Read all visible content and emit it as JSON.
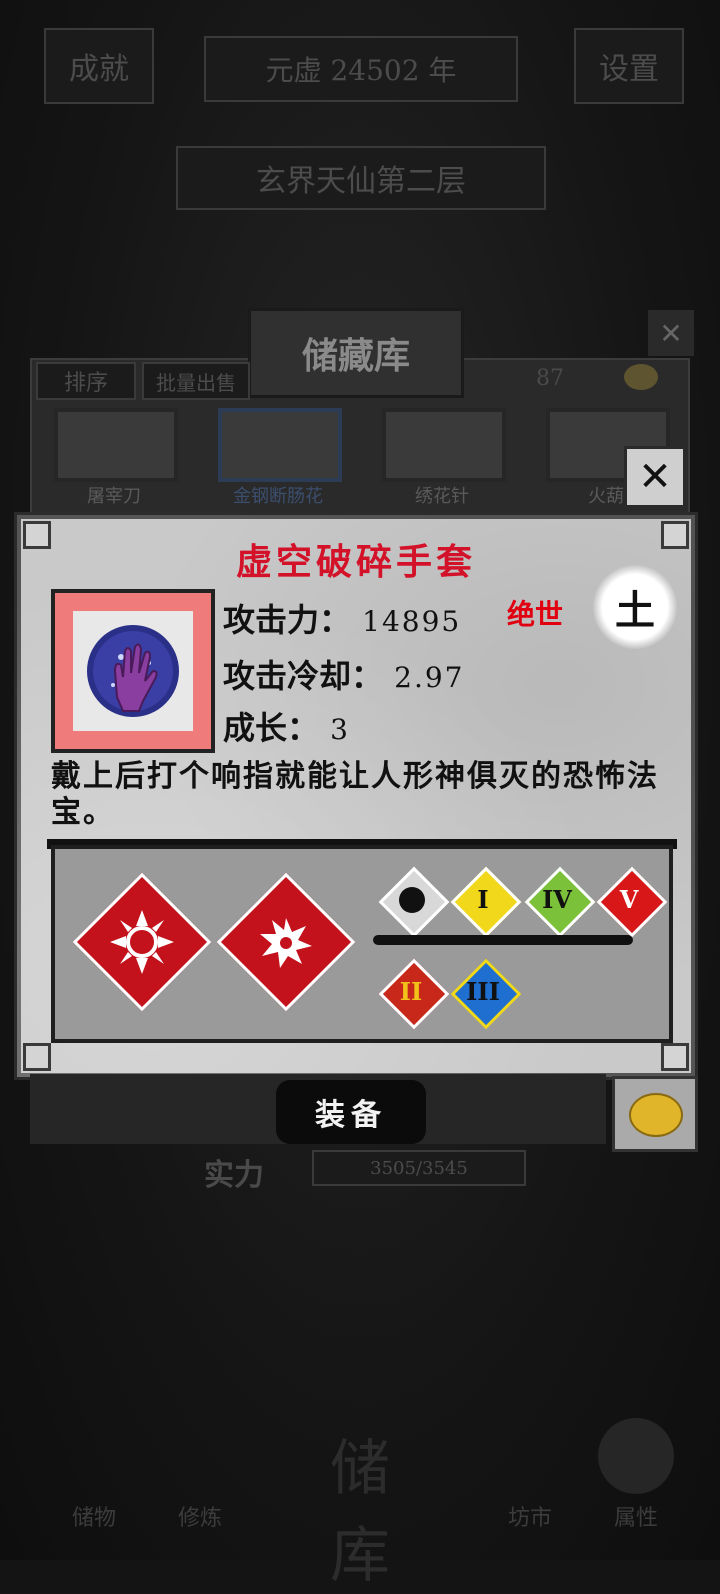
{
  "background": {
    "top_left_button": "成就",
    "year_banner": "元虚 24502 年",
    "settings_button": "设置",
    "realm_banner": "玄界天仙第二层",
    "storage": {
      "title": "储藏库",
      "sort_button": "排序",
      "batch_sell_button": "批量出售",
      "coin_count": "87",
      "items": [
        "屠宰刀",
        "金钢断肠花",
        "绣花针",
        "火葫"
      ]
    },
    "power_label": "实力",
    "power_value": "3505/3545",
    "nav": [
      "储物",
      "修炼",
      "储库",
      "坊市",
      "属性"
    ]
  },
  "item": {
    "name": "虚空破碎手套",
    "attack_label": "攻击力：",
    "attack_value": "14895",
    "cooldown_label": "攻击冷却：",
    "cooldown_value": "2.97",
    "growth_label": "成长：",
    "growth_value": "3",
    "rarity": "绝世",
    "element": "土",
    "description": "戴上后打个响指就能让人形神俱灭的恐怖法宝。",
    "icon": "void-gauntlet-icon"
  },
  "skills": {
    "primary": [
      "shatter-ring-icon",
      "burst-icon"
    ],
    "effects_row1": [
      {
        "icon": "bomb-icon",
        "label": ""
      },
      {
        "icon": "lightning-icon",
        "label": "I"
      },
      {
        "icon": "leaf-icon",
        "label": "IV"
      },
      {
        "icon": "fire-icon",
        "label": "V"
      }
    ],
    "effects_row2": [
      {
        "icon": "flame-icon",
        "label": "II"
      },
      {
        "icon": "water-icon",
        "label": "III"
      }
    ]
  },
  "actions": {
    "equip_button": "装备",
    "close_symbol": "✕"
  },
  "colors": {
    "title_red": "#d3122a",
    "rarity_red": "#e00010",
    "skill_red": "#c3121b"
  }
}
